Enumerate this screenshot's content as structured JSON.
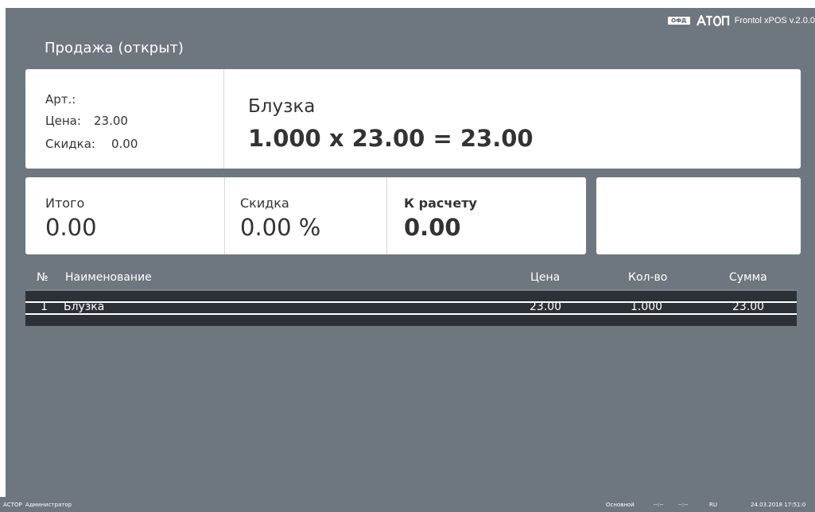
{
  "header": {
    "ofd_badge": "ОФД",
    "logo_icon": "aton-logo",
    "version": "Frontol xPOS v.2.0.0",
    "mode_title": "Продажа (открыт)"
  },
  "item_card": {
    "art_label": "Арт.:",
    "art_value": "",
    "price_label": "Цена:",
    "price_value": "23.00",
    "discount_label": "Скидка:",
    "discount_value": "0.00",
    "name": "Блузка",
    "calculation": "1.000 x 23.00 = 23.00"
  },
  "totals": {
    "total_label": "Итого",
    "total_value": "0.00",
    "discount_label": "Скидка",
    "discount_value": "0.00 %",
    "payable_label": "К расчету",
    "payable_value": "0.00"
  },
  "table": {
    "columns": {
      "num": "№",
      "name": "Наименование",
      "price": "Цена",
      "qty": "Кол-во",
      "sum": "Сумма"
    },
    "rows": [
      {
        "num": "1",
        "name": "Блузка",
        "price": "23.00",
        "qty": "1.000",
        "sum": "23.00",
        "selected": true
      }
    ]
  },
  "statusbar": {
    "company": "АСТОР",
    "user": "Администратор",
    "price_list": "Основной",
    "field1": "--:--",
    "field2": "--:--",
    "language": "RU",
    "datetime": "24.03.2018 17:51:0"
  },
  "colors": {
    "background": "#6e7780",
    "card": "#ffffff",
    "selected_row": "#2b3136",
    "text_dark": "#333333"
  }
}
